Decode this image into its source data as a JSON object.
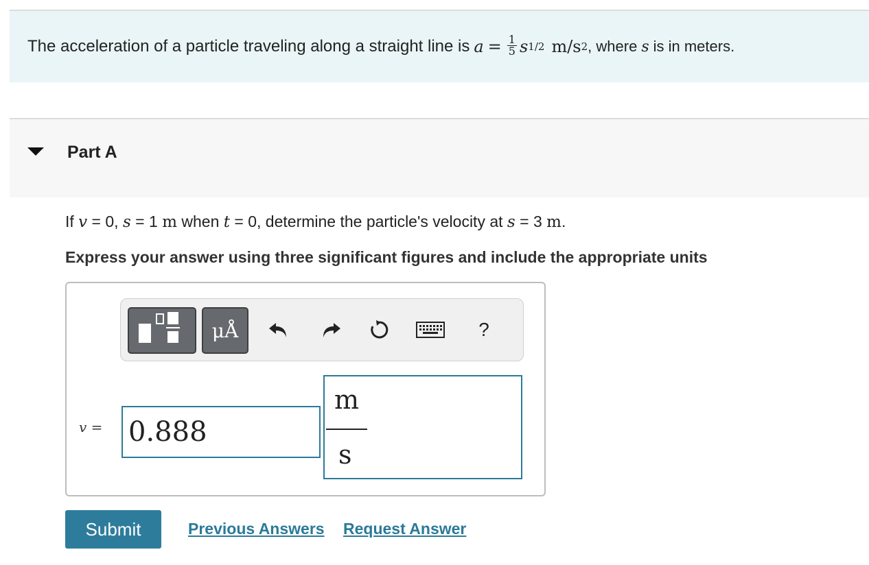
{
  "problem": {
    "text_before": "The acceleration of a particle traveling along a straight line is ",
    "eq_a": "a",
    "eq_equals": " = ",
    "frac_num": "1",
    "frac_den": "5",
    "eq_s": "s",
    "eq_exp": "1/2",
    "eq_units": "m/s",
    "eq_units_exp": "2",
    "text_after_1": ", where ",
    "text_after_s": "s",
    "text_after_2": " is in meters."
  },
  "part": {
    "title": "Part A",
    "q_if": "If ",
    "q_v": "v",
    "q_1": " = 0, ",
    "q_s": "s",
    "q_2": " = 1 ",
    "q_m": "m",
    "q_3": " when ",
    "q_t": "t",
    "q_4": " = 0, determine the particle's velocity at ",
    "q_s2": "s",
    "q_5": " = 3 ",
    "q_m2": "m",
    "q_6": ".",
    "instruction": "Express your answer using three significant figures and include the appropriate units"
  },
  "toolbar": {
    "units_label": "μÅ",
    "help_label": "?"
  },
  "answer": {
    "var_label": "v =",
    "value": "0.888",
    "unit_numerator": "m",
    "unit_denominator": "s"
  },
  "actions": {
    "submit": "Submit",
    "previous_answers": "Previous Answers",
    "request_answer": "Request Answer"
  },
  "colors": {
    "accent": "#2e7c9c",
    "problem_bg": "#e9f5f7",
    "button_gray": "#666a6e"
  }
}
